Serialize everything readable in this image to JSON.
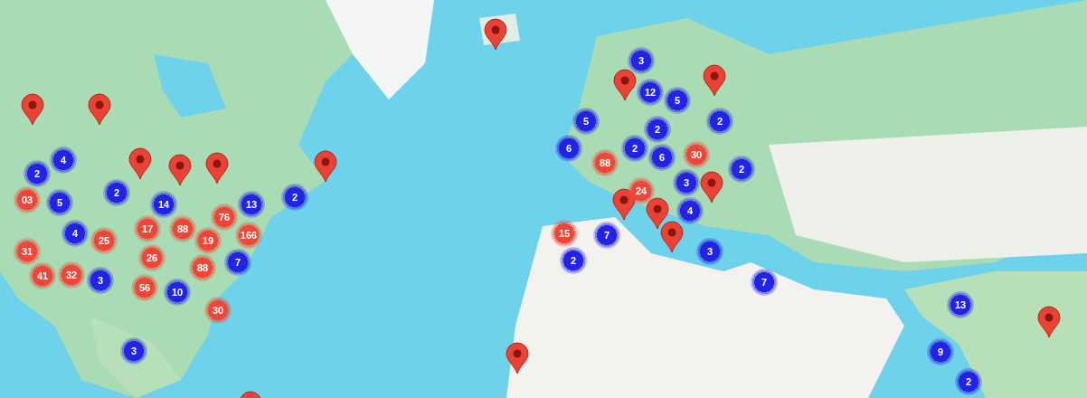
{
  "map": {
    "kind": "picture",
    "clusters": [
      {
        "count": "4",
        "color": "#2323e8"
      },
      {
        "count": "2",
        "color": "#2323e8"
      },
      {
        "count": "03",
        "color": "#ef4638"
      },
      {
        "count": "5",
        "color": "#2323e8"
      },
      {
        "count": "2",
        "color": "#2323e8"
      },
      {
        "count": "14",
        "color": "#2323e8"
      },
      {
        "count": "13",
        "color": "#2323e8"
      },
      {
        "count": "2",
        "color": "#2323e8"
      },
      {
        "count": "4",
        "color": "#2323e8"
      },
      {
        "count": "25",
        "color": "#ef4638"
      },
      {
        "count": "17",
        "color": "#ef4638"
      },
      {
        "count": "88",
        "color": "#ef4638"
      },
      {
        "count": "76",
        "color": "#ef4638"
      },
      {
        "count": "19",
        "color": "#ef4638"
      },
      {
        "count": "166",
        "color": "#ef4638"
      },
      {
        "count": "31",
        "color": "#ef4638"
      },
      {
        "count": "26",
        "color": "#ef4638"
      },
      {
        "count": "7",
        "color": "#2323e8"
      },
      {
        "count": "41",
        "color": "#ef4638"
      },
      {
        "count": "32",
        "color": "#ef4638"
      },
      {
        "count": "3",
        "color": "#2323e8"
      },
      {
        "count": "56",
        "color": "#ef4638"
      },
      {
        "count": "10",
        "color": "#2323e8"
      },
      {
        "count": "88",
        "color": "#ef4638"
      },
      {
        "count": "30",
        "color": "#ef4638"
      },
      {
        "count": "3",
        "color": "#2323e8"
      },
      {
        "count": "3",
        "color": "#2323e8"
      },
      {
        "count": "12",
        "color": "#2323e8"
      },
      {
        "count": "5",
        "color": "#2323e8"
      },
      {
        "count": "5",
        "color": "#2323e8"
      },
      {
        "count": "2",
        "color": "#2323e8"
      },
      {
        "count": "2",
        "color": "#2323e8"
      },
      {
        "count": "6",
        "color": "#2323e8"
      },
      {
        "count": "2",
        "color": "#2323e8"
      },
      {
        "count": "6",
        "color": "#2323e8"
      },
      {
        "count": "30",
        "color": "#ef4638"
      },
      {
        "count": "88",
        "color": "#ef4638"
      },
      {
        "count": "2",
        "color": "#2323e8"
      },
      {
        "count": "24",
        "color": "#ef4638"
      },
      {
        "count": "3",
        "color": "#2323e8"
      },
      {
        "count": "4",
        "color": "#2323e8"
      },
      {
        "count": "15",
        "color": "#ef4638"
      },
      {
        "count": "7",
        "color": "#2323e8"
      },
      {
        "count": "2",
        "color": "#2323e8"
      },
      {
        "count": "3",
        "color": "#2323e8"
      },
      {
        "count": "7",
        "color": "#2323e8"
      },
      {
        "count": "13",
        "color": "#2323e8"
      },
      {
        "count": "9",
        "color": "#2323e8"
      },
      {
        "count": "2",
        "color": "#2323e8"
      }
    ]
  }
}
